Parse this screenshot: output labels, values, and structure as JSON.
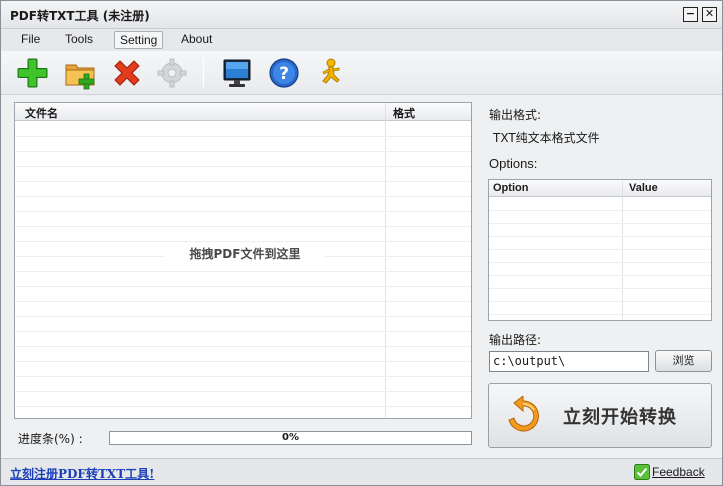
{
  "window": {
    "title": "PDF转TXT工具 (未注册)",
    "minimize_glyph": "−",
    "close_glyph": "✕"
  },
  "menu": {
    "items": [
      {
        "label": "File"
      },
      {
        "label": "Tools"
      },
      {
        "label": "Setting",
        "active": true
      },
      {
        "label": "About"
      }
    ]
  },
  "toolbar": {
    "buttons": [
      {
        "icon": "add-icon"
      },
      {
        "icon": "add-folder-icon"
      },
      {
        "icon": "delete-icon"
      },
      {
        "icon": "settings-gear-icon",
        "disabled": true
      },
      {
        "icon": "monitor-icon"
      },
      {
        "icon": "help-icon"
      },
      {
        "icon": "running-man-icon"
      }
    ]
  },
  "file_list": {
    "columns": [
      "文件名",
      "格式"
    ],
    "drop_hint": "拖拽PDF文件到这里",
    "rows": []
  },
  "progress": {
    "label": "进度条(%) :",
    "value_text": "0%",
    "value": 0
  },
  "output_format": {
    "label": "输出格式:",
    "value": "TXT纯文本格式文件"
  },
  "options": {
    "label": "Options:",
    "columns": [
      "Option",
      "Value"
    ],
    "rows": []
  },
  "output_path": {
    "label": "输出路径:",
    "value": "c:\\output\\",
    "browse_label": "浏览"
  },
  "convert": {
    "label": "立刻开始转换"
  },
  "status_bar": {
    "register_link": "立刻注册PDF转TXT工具!",
    "feedback_label": "Feedback"
  },
  "colors": {
    "accent_blue": "#1a3fb8",
    "window_bg": "#eef0f2",
    "convert_icon_orange": "#f29a1d"
  }
}
